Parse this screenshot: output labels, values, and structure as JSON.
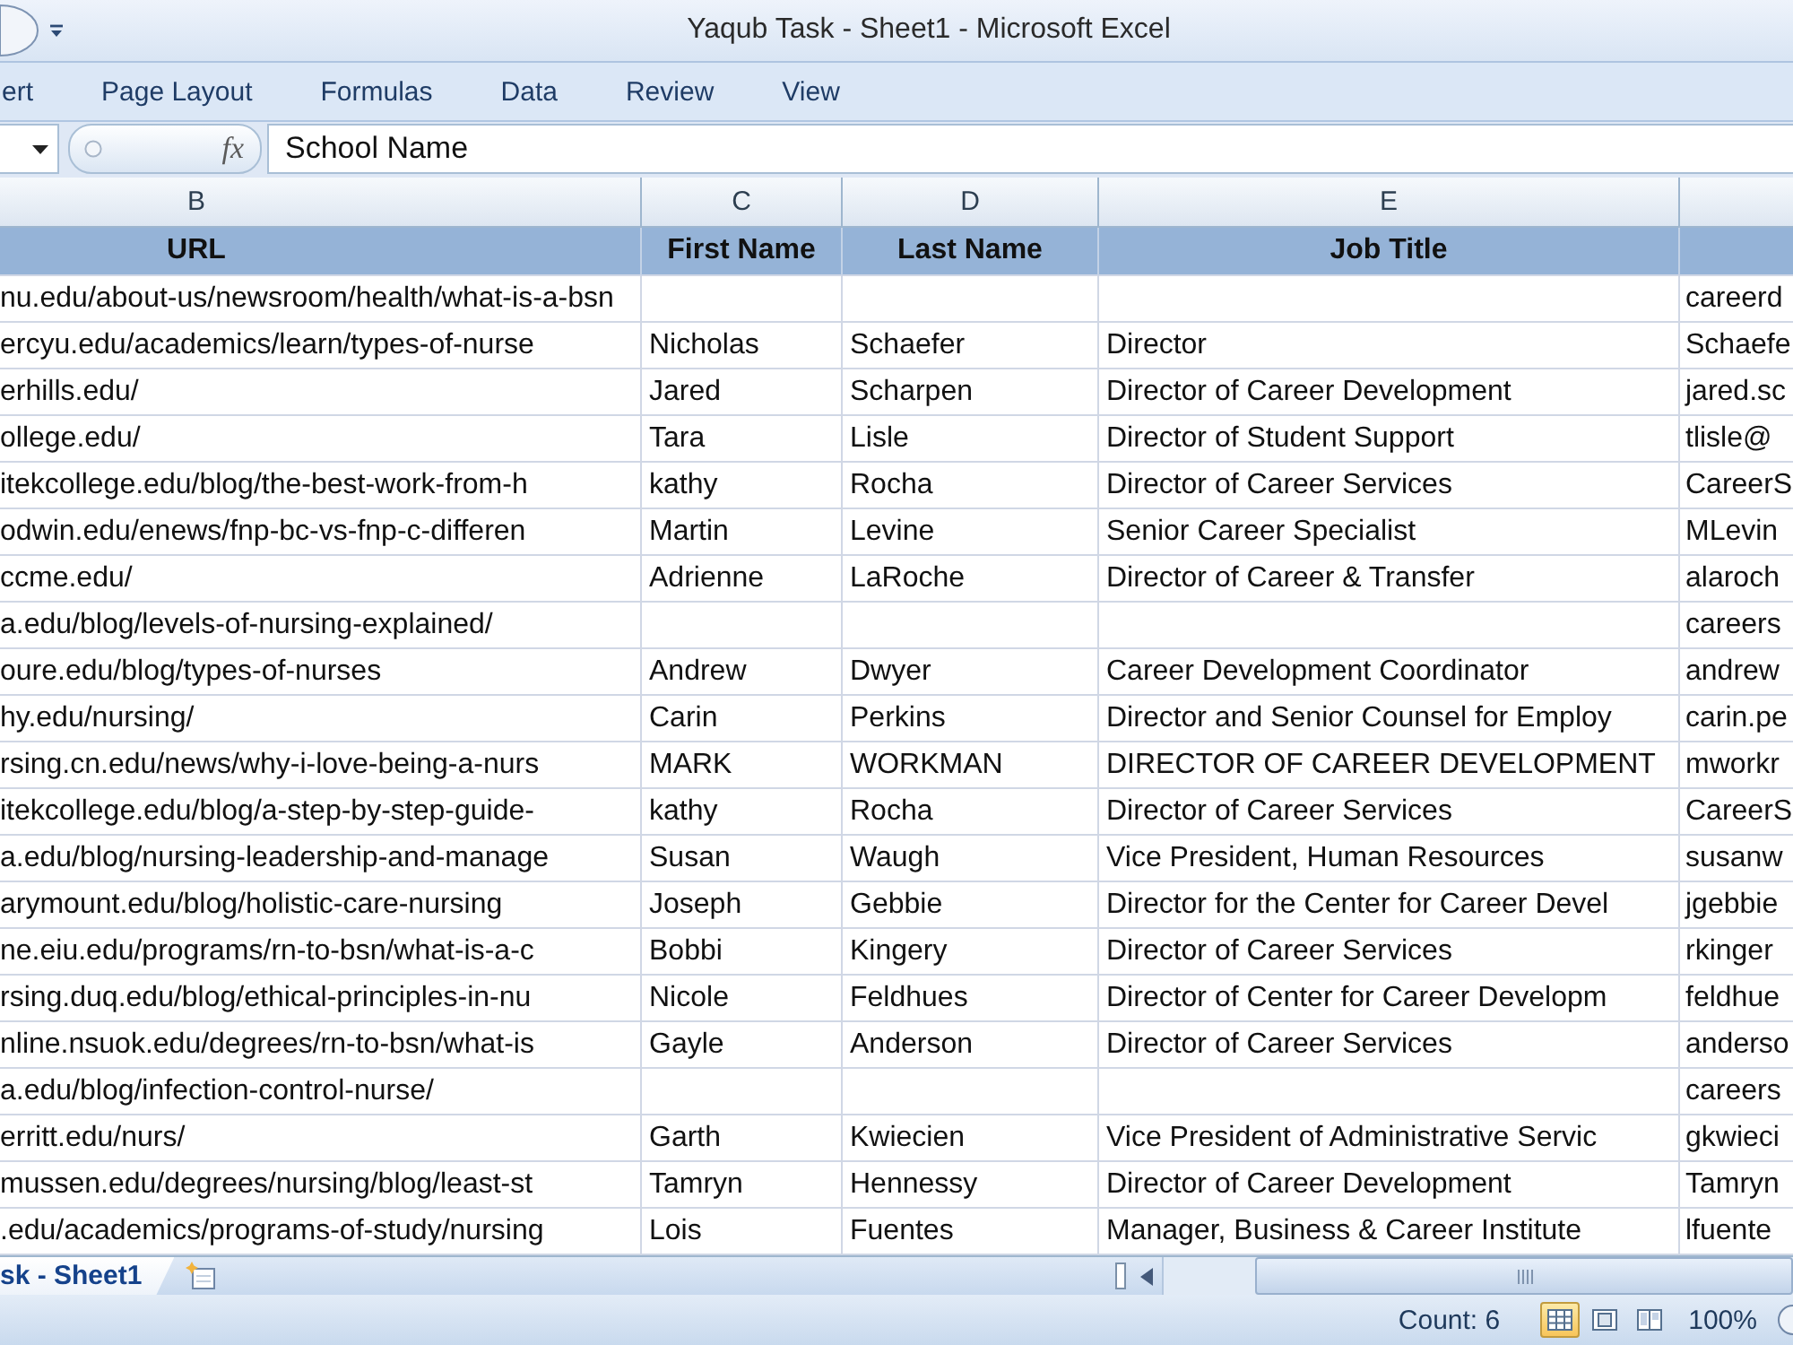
{
  "window": {
    "title": "Yaqub Task - Sheet1 - Microsoft Excel"
  },
  "ribbon_tabs": [
    {
      "label": "ert",
      "selected": false
    },
    {
      "label": "Page Layout",
      "selected": false
    },
    {
      "label": "Formulas",
      "selected": false
    },
    {
      "label": "Data",
      "selected": false
    },
    {
      "label": "Review",
      "selected": false
    },
    {
      "label": "View",
      "selected": false
    }
  ],
  "formula_bar": {
    "function_label": "fx",
    "value": "School Name"
  },
  "sheet": {
    "columns": [
      {
        "letter": "B",
        "heading": "URL"
      },
      {
        "letter": "C",
        "heading": "First Name"
      },
      {
        "letter": "D",
        "heading": "Last Name"
      },
      {
        "letter": "E",
        "heading": "Job Title"
      }
    ],
    "rows": [
      {
        "url": "nu.edu/about-us/newsroom/health/what-is-a-bsn",
        "column_5": "careerd"
      },
      {
        "url": "ercyu.edu/academics/learn/types-of-nurse",
        "first_name": "Nicholas",
        "last_name": "Schaefer",
        "job_title": "Director",
        "column_5": "Schaefe"
      },
      {
        "url": "erhills.edu/",
        "first_name": "Jared",
        "last_name": "Scharpen",
        "job_title": "Director of Career Development",
        "column_5": "jared.sc"
      },
      {
        "url": "ollege.edu/",
        "first_name": "Tara",
        "last_name": "Lisle",
        "job_title": "Director of Student Support",
        "column_5": "tlisle@"
      },
      {
        "url": "itekcollege.edu/blog/the-best-work-from-h",
        "first_name": "kathy",
        "last_name": "Rocha",
        "job_title": "Director of Career Services",
        "column_5": "CareerS"
      },
      {
        "url": "odwin.edu/enews/fnp-bc-vs-fnp-c-differen",
        "first_name": "Martin",
        "last_name": "Levine",
        "job_title": "Senior Career Specialist",
        "column_5": "MLevin"
      },
      {
        "url": "ccme.edu/",
        "first_name": "Adrienne",
        "last_name": "LaRoche",
        "job_title": "Director of Career & Transfer",
        "column_5": "alaroch"
      },
      {
        "url": "a.edu/blog/levels-of-nursing-explained/",
        "column_5": "careers"
      },
      {
        "url": "oure.edu/blog/types-of-nurses",
        "first_name": "Andrew",
        "last_name": "Dwyer",
        "job_title": "Career Development Coordinator",
        "column_5": "andrew"
      },
      {
        "url": "hy.edu/nursing/",
        "first_name": "Carin",
        "last_name": "Perkins",
        "job_title": "Director and Senior Counsel for Employ",
        "column_5": "carin.pe"
      },
      {
        "url": "rsing.cn.edu/news/why-i-love-being-a-nurs",
        "first_name": "MARK",
        "last_name": "WORKMAN",
        "job_title": "DIRECTOR OF CAREER DEVELOPMENT",
        "column_5": "mworkr"
      },
      {
        "url": "itekcollege.edu/blog/a-step-by-step-guide-",
        "first_name": "kathy",
        "last_name": "Rocha",
        "job_title": "Director of Career Services",
        "column_5": "CareerS"
      },
      {
        "url": "a.edu/blog/nursing-leadership-and-manage",
        "first_name": "Susan",
        "last_name": "Waugh",
        "job_title": "Vice President, Human Resources",
        "column_5": "susanw"
      },
      {
        "url": "arymount.edu/blog/holistic-care-nursing",
        "first_name": "Joseph",
        "last_name": "Gebbie",
        "job_title": "Director for the Center for Career Devel",
        "column_5": "jgebbie"
      },
      {
        "url": "ne.eiu.edu/programs/rn-to-bsn/what-is-a-c",
        "first_name": "Bobbi",
        "last_name": "Kingery",
        "job_title": "Director of Career Services",
        "column_5": "rkinger"
      },
      {
        "url": "rsing.duq.edu/blog/ethical-principles-in-nu",
        "first_name": "Nicole",
        "last_name": "Feldhues",
        "job_title": "Director of Center for Career Developm",
        "column_5": "feldhue"
      },
      {
        "url": "nline.nsuok.edu/degrees/rn-to-bsn/what-is",
        "first_name": "Gayle",
        "last_name": "Anderson",
        "job_title": "Director of Career Services",
        "column_5": "anderso"
      },
      {
        "url": "a.edu/blog/infection-control-nurse/",
        "column_5": "careers"
      },
      {
        "url": "erritt.edu/nurs/",
        "first_name": "Garth",
        "last_name": "Kwiecien",
        "job_title": "Vice President of Administrative Servic",
        "column_5": "gkwieci"
      },
      {
        "url": "mussen.edu/degrees/nursing/blog/least-st",
        "first_name": "Tamryn",
        "last_name": "Hennessy",
        "job_title": "Director of Career Development",
        "column_5": "Tamryn"
      },
      {
        "url": ".edu/academics/programs-of-study/nursing",
        "first_name": "Lois",
        "last_name": "Fuentes",
        "job_title": "Manager, Business & Career Institute",
        "column_5": "lfuente"
      }
    ]
  },
  "sheet_tabs": [
    {
      "label": "sk - Sheet1",
      "selected": true
    }
  ],
  "status_bar": {
    "count": "Count: 6",
    "views": [
      {
        "kind": "normal",
        "selected": true
      },
      {
        "kind": "page_layout",
        "selected": false
      },
      {
        "kind": "page_break_preview",
        "selected": false
      }
    ],
    "zoom": "100%"
  }
}
